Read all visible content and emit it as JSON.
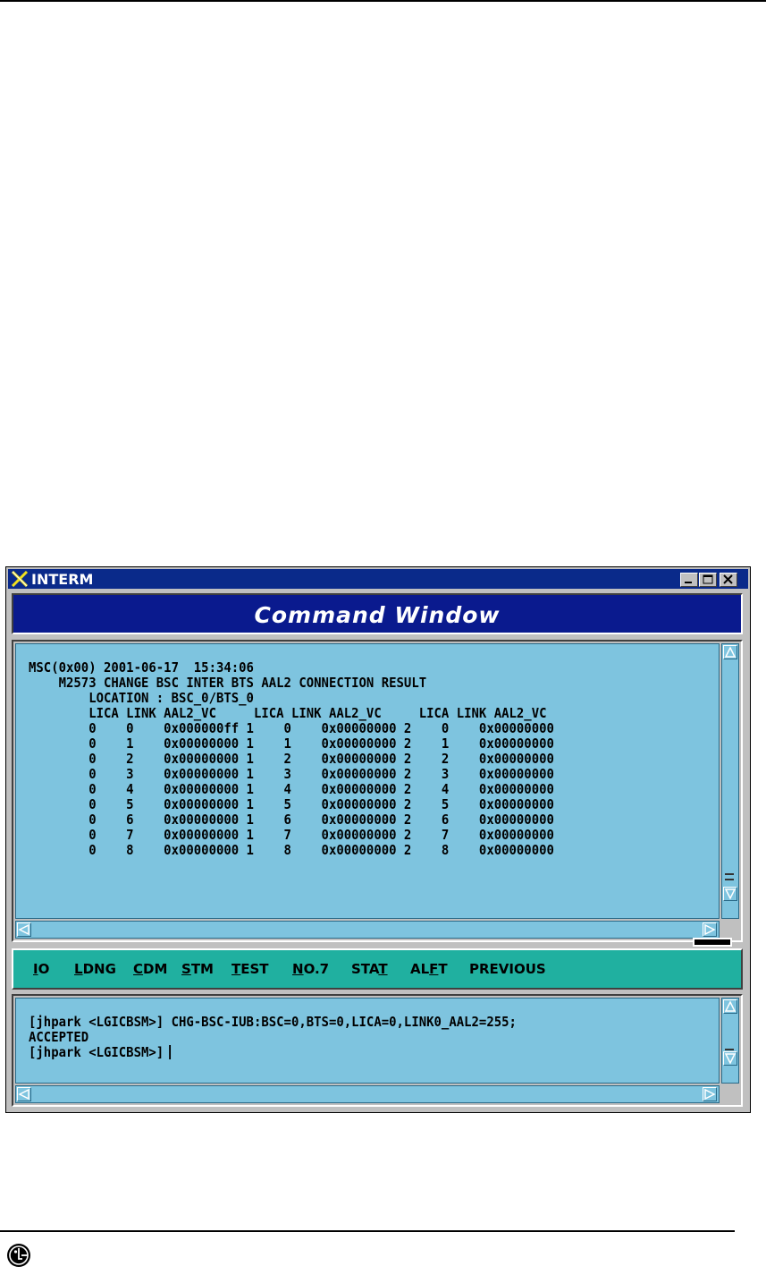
{
  "window": {
    "title": "INTERM",
    "header": "Command Window"
  },
  "output": {
    "lines": [
      "MSC(0x00) 2001-06-17  15:34:06",
      "    M2573 CHANGE BSC INTER BTS AAL2 CONNECTION RESULT",
      "        LOCATION : BSC_0/BTS_0",
      "        LICA LINK AAL2_VC     LICA LINK AAL2_VC     LICA LINK AAL2_VC",
      "        0    0    0x000000ff 1    0    0x00000000 2    0    0x00000000",
      "        0    1    0x00000000 1    1    0x00000000 2    1    0x00000000",
      "        0    2    0x00000000 1    2    0x00000000 2    2    0x00000000",
      "        0    3    0x00000000 1    3    0x00000000 2    3    0x00000000",
      "        0    4    0x00000000 1    4    0x00000000 2    4    0x00000000",
      "        0    5    0x00000000 1    5    0x00000000 2    5    0x00000000",
      "        0    6    0x00000000 1    6    0x00000000 2    6    0x00000000",
      "        0    7    0x00000000 1    7    0x00000000 2    7    0x00000000",
      "        0    8    0x00000000 1    8    0x00000000 2    8    0x00000000"
    ]
  },
  "menu": {
    "io_key": "I",
    "io_rest": "O",
    "ldng_key": "L",
    "ldng_rest": "DNG",
    "cdm_key": "C",
    "cdm_rest": "DM",
    "stm_key": "S",
    "stm_rest": "TM",
    "test_key": "T",
    "test_rest": "EST",
    "no7_key": "N",
    "no7_rest": "O.7",
    "stat_pre": "STA",
    "stat_key": "T",
    "alft_pre": "AL",
    "alft_key": "F",
    "alft_rest": "T",
    "previous": "PREVIOUS"
  },
  "input": {
    "line1": "[jhpark <LGICBSM>] CHG-BSC-IUB:BSC=0,BTS=0,LICA=0,LINK0_AAL2=255;",
    "line2": "ACCEPTED",
    "line3": "[jhpark <LGICBSM>]"
  },
  "colors": {
    "title_bar": "#0a2a8a",
    "header_bar": "#0a1a8e",
    "panel_bg": "#7ec4df",
    "menu_bg": "#20b0a0",
    "frame": "#c0c0c0"
  },
  "icons": [
    "x-logo-icon",
    "minimize-icon",
    "maximize-icon",
    "close-icon",
    "scroll-up-icon",
    "scroll-down-icon",
    "scroll-left-icon",
    "scroll-right-icon",
    "lg-logo-icon"
  ]
}
